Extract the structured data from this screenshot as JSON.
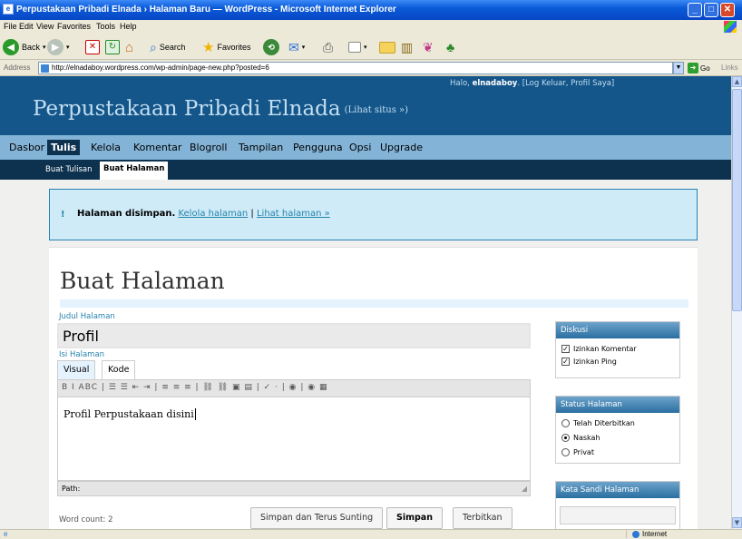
{
  "window": {
    "title": "Perpustakaan Pribadi Elnada › Halaman Baru — WordPress - Microsoft Internet Explorer"
  },
  "menu": [
    "File",
    "Edit",
    "View",
    "Favorites",
    "Tools",
    "Help"
  ],
  "toolbar": {
    "back": "Back",
    "search": "Search",
    "favorites": "Favorites"
  },
  "address": {
    "label": "Address",
    "url": "http://elnadaboy.wordpress.com/wp-admin/page-new.php?posted=6",
    "go": "Go",
    "links": "Links"
  },
  "wp": {
    "blog_name": "Perpustakaan Pribadi Elnada",
    "visit_site": "(Lihat situs »)",
    "greeting": "Halo, ",
    "username": "elnadaboy",
    "logout": ". [Log Keluar, Profil Saya]",
    "admin_menu": [
      "Dasbor",
      "Tulis",
      "Kelola",
      "Komentar",
      "Blogroll",
      "Tampilan",
      "Pengguna",
      "Opsi",
      "Upgrade"
    ],
    "sub_menu": [
      "Buat Tulisan",
      "Buat Halaman"
    ],
    "notice": {
      "icon": "!",
      "bold": "Halaman disimpan.",
      "link1": "Kelola halaman",
      "sep": " | ",
      "link2": "Lihat halaman »"
    },
    "page_title": "Buat Halaman",
    "title_label": "Judul Halaman",
    "title_value": "Profil",
    "content_label": "Isi Halaman",
    "tabs": [
      "Visual",
      "Kode"
    ],
    "editor_toolbar": "B  I  ABC | ☰ ☰ ⇤ ⇥ | ≡ ≡ ≡ | ⛓ ⛓ ▣ ▤ | ✓ · | ◉ | ◉ ▦",
    "editor_content": "Profil Perpustakaan disini",
    "path_label": "Path:",
    "word_count": "Word count: 2",
    "buttons": [
      "Simpan dan Terus Sunting",
      "Simpan",
      "Terbitkan"
    ],
    "discussion": {
      "header": "Diskusi",
      "allow_comments": "Izinkan Komentar",
      "allow_pings": "Izinkan Ping"
    },
    "status": {
      "header": "Status Halaman",
      "options": [
        "Telah Diterbitkan",
        "Naskah",
        "Privat"
      ],
      "selected": "Naskah"
    },
    "password": {
      "header": "Kata Sandi Halaman"
    }
  },
  "statusbar": {
    "zone": "Internet"
  },
  "colors": {
    "wp_header": "#14568a",
    "wp_menu": "#83b4d8",
    "wp_submenu": "#0d324f",
    "link": "#2583ad",
    "xp_titlebar": "#0a5bd8"
  }
}
